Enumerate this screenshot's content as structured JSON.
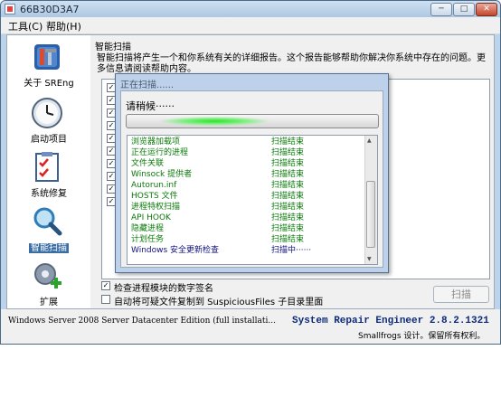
{
  "window": {
    "title": "66B30D3A7",
    "min_label": "─",
    "max_label": "□",
    "close_label": "✕"
  },
  "menu": {
    "tools": "工具(C)",
    "help": "帮助(H)"
  },
  "sidebar": {
    "items": [
      {
        "label": "关于 SREng",
        "icon": "tools-icon"
      },
      {
        "label": "启动项目",
        "icon": "clock-icon"
      },
      {
        "label": "系统修复",
        "icon": "checklist-icon"
      },
      {
        "label": "智能扫描",
        "icon": "magnifier-icon"
      },
      {
        "label": "扩展",
        "icon": "gear-plus-icon"
      }
    ],
    "active_index": 3
  },
  "main": {
    "section_title": "智能扫描",
    "description": "智能扫描将产生一个和你系统有关的详细报告。这个报告能够帮助你解决你系统中存在的问题。更多信息请阅读帮助内容。",
    "options": [
      {
        "label": "检查进程模块的数字签名",
        "checked": true
      },
      {
        "label": "自动将可疑文件复制到 SuspiciousFiles 子目录里面",
        "checked": false
      }
    ],
    "scan_button": "扫描"
  },
  "dialog": {
    "title": "正在扫描......",
    "wait_text": "请稍候······",
    "progress": 0.35,
    "rows": [
      {
        "name": "浏览器加载项",
        "status": "扫描结束"
      },
      {
        "name": "正在运行的进程",
        "status": "扫描结束"
      },
      {
        "name": "文件关联",
        "status": "扫描结束"
      },
      {
        "name": "Winsock 提供者",
        "status": "扫描结束"
      },
      {
        "name": "Autorun.inf",
        "status": "扫描结束"
      },
      {
        "name": "HOSTS 文件",
        "status": "扫描结束"
      },
      {
        "name": "进程特权扫描",
        "status": "扫描结束"
      },
      {
        "name": "API HOOK",
        "status": "扫描结束"
      },
      {
        "name": "隐藏进程",
        "status": "扫描结束"
      },
      {
        "name": "计划任务",
        "status": "扫描结束"
      },
      {
        "name": "Windows 安全更新检查",
        "status": "扫描中······"
      }
    ]
  },
  "status": {
    "os": "Windows Server 2008 Server Datacenter Edition (full installati...",
    "product": "System Repair Engineer 2.8.2.1321",
    "credit": "Smallfrogs 设计。保留所有权利。"
  }
}
